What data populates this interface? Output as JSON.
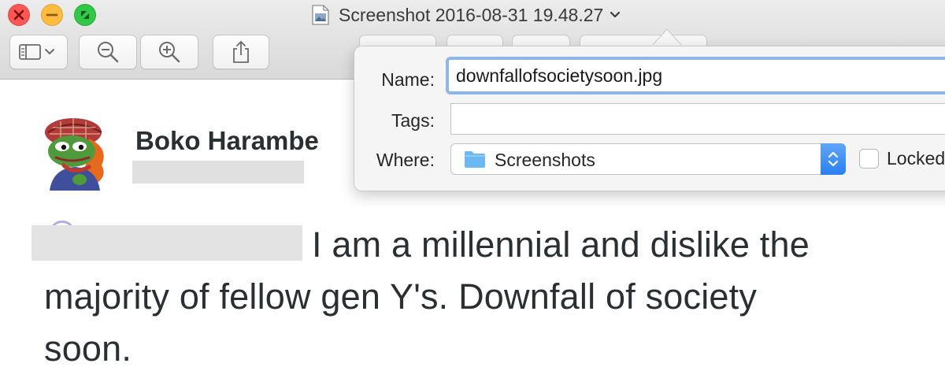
{
  "window": {
    "title": "Screenshot 2016-08-31 19.48.27",
    "controls": {
      "close_icon": "close-icon",
      "minimize_icon": "minimize-icon",
      "zoom_icon": "fullscreen-icon"
    },
    "toolbar": {
      "sidebar_icon": "sidebar-toggle-icon",
      "zoom_out_icon": "zoom-out-icon",
      "zoom_in_icon": "zoom-in-icon",
      "share_icon": "share-icon"
    }
  },
  "tweet": {
    "display_name": "Boko Harambe",
    "text_lines": [
      "I am a millennial and dislike the",
      "majority of fellow gen Y's. Downfall of society",
      "soon."
    ]
  },
  "save_dialog": {
    "name_label": "Name:",
    "name_value": "downfallofsocietysoon.jpg",
    "tags_label": "Tags:",
    "tags_value": "",
    "where_label": "Where:",
    "where_value": "Screenshots",
    "locked_label": "Locked",
    "locked_checked": false
  },
  "colors": {
    "accent_blue": "#2c7ff2",
    "focus_ring": "#8fb5ea",
    "folder": "#6cb8f2",
    "text": "#292f33"
  }
}
